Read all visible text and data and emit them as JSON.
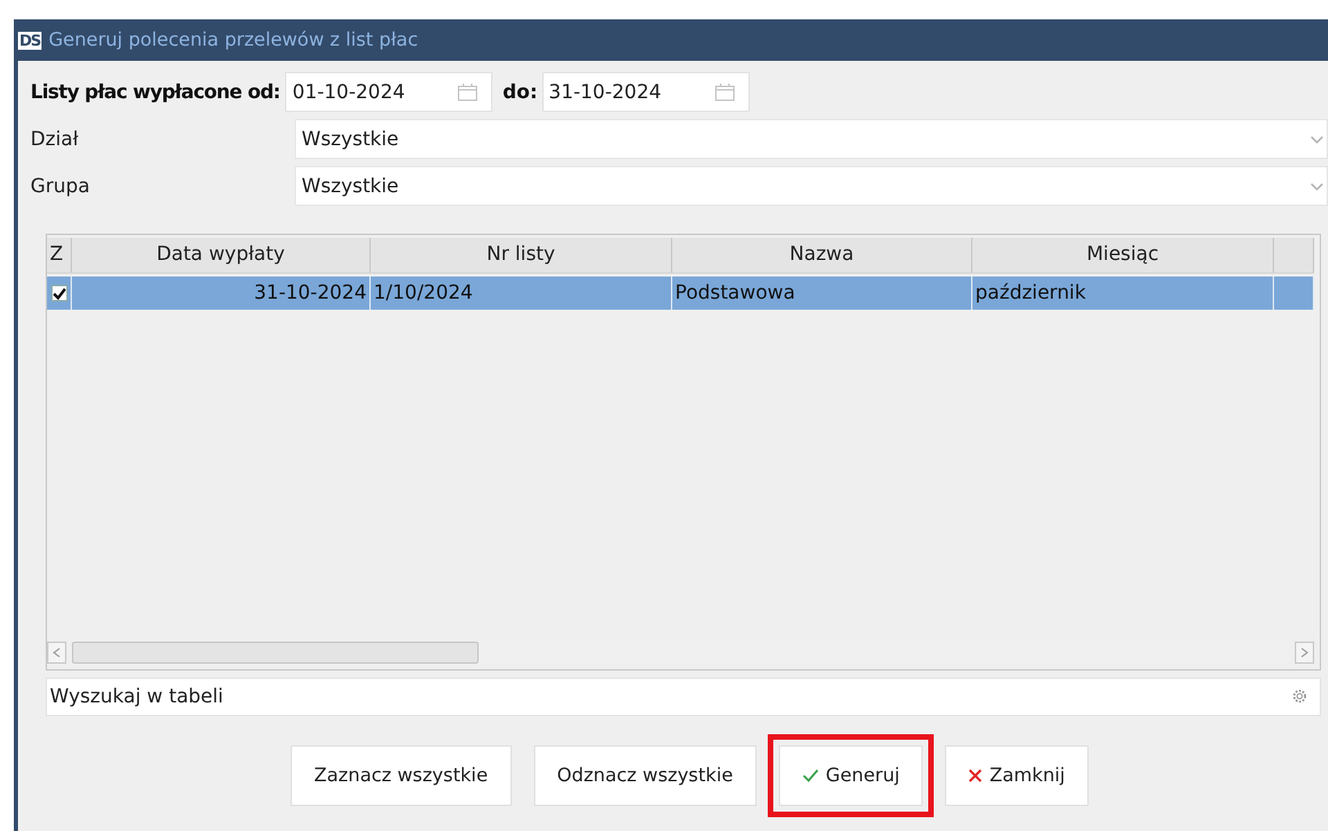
{
  "window": {
    "logo": "DS",
    "title": "Generuj polecenia przelewów z list płac"
  },
  "filters": {
    "date_from": {
      "label": "Listy płac wypłacone od:",
      "value": "01-10-2024"
    },
    "date_to": {
      "label": "do:",
      "value": "31-10-2024"
    },
    "department": {
      "label": "Dział",
      "value": "Wszystkie"
    },
    "group": {
      "label": "Grupa",
      "value": "Wszystkie"
    }
  },
  "table": {
    "columns": [
      "Z",
      "Data wypłaty",
      "Nr listy",
      "Nazwa",
      "Miesiąc"
    ],
    "rows": [
      {
        "checked": true,
        "selected": true,
        "cells": [
          "31-10-2024",
          "1/10/2024",
          "Podstawowa",
          "październik"
        ]
      }
    ]
  },
  "search": {
    "placeholder": "Wyszukaj w tabeli"
  },
  "buttons": [
    {
      "label": "Zaznacz wszystkie",
      "kind": "plain",
      "highlighted": false
    },
    {
      "label": "Odznacz wszystkie",
      "kind": "plain",
      "highlighted": false
    },
    {
      "label": "Generuj",
      "kind": "confirm",
      "highlighted": true
    },
    {
      "label": "Zamknij",
      "kind": "cancel",
      "highlighted": false
    }
  ]
}
